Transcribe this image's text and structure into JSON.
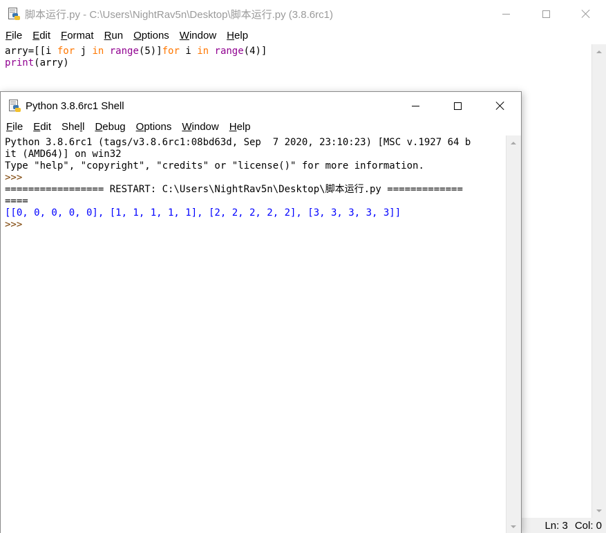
{
  "editor": {
    "title": "脚本运行.py - C:\\Users\\NightRav5n\\Desktop\\脚本运行.py (3.8.6rc1)",
    "menu": [
      {
        "label": "File",
        "mnemonic": "F",
        "rest": "ile"
      },
      {
        "label": "Edit",
        "mnemonic": "E",
        "rest": "dit"
      },
      {
        "label": "Format",
        "mnemonic": "F",
        "rest": "ormat"
      },
      {
        "label": "Run",
        "mnemonic": "R",
        "rest": "un"
      },
      {
        "label": "Options",
        "mnemonic": "O",
        "rest": "ptions"
      },
      {
        "label": "Window",
        "mnemonic": "W",
        "rest": "indow"
      },
      {
        "label": "Help",
        "mnemonic": "H",
        "rest": "elp"
      }
    ],
    "code": {
      "line1": {
        "a": "arry=[[i ",
        "kw1": "for",
        "b": " j ",
        "kw2": "in",
        "c": " ",
        "bi1": "range",
        "d": "(5)]",
        "kw3": "for",
        "e": " i ",
        "kw4": "in",
        "f": " ",
        "bi2": "range",
        "g": "(4)]"
      },
      "line2": {
        "bi": "print",
        "rest": "(arry)"
      }
    },
    "status": {
      "line": "Ln: 3",
      "col": "Col: 0"
    }
  },
  "shell": {
    "title": "Python 3.8.6rc1 Shell",
    "menu": [
      {
        "label": "File",
        "mnemonic": "F",
        "rest": "ile"
      },
      {
        "label": "Edit",
        "mnemonic": "E",
        "rest": "dit"
      },
      {
        "label": "Shell",
        "pre": "She",
        "mnemonic": "l",
        "rest": "l"
      },
      {
        "label": "Debug",
        "mnemonic": "D",
        "rest": "ebug"
      },
      {
        "label": "Options",
        "mnemonic": "O",
        "rest": "ptions"
      },
      {
        "label": "Window",
        "mnemonic": "W",
        "rest": "indow"
      },
      {
        "label": "Help",
        "mnemonic": "H",
        "rest": "elp"
      }
    ],
    "banner1": "Python 3.8.6rc1 (tags/v3.8.6rc1:08bd63d, Sep  7 2020, 23:10:23) [MSC v.1927 64 b",
    "banner2": "it (AMD64)] on win32",
    "banner3": "Type \"help\", \"copyright\", \"credits\" or \"license()\" for more information.",
    "prompt": ">>> ",
    "restart1": "================= RESTART: C:\\Users\\NightRav5n\\Desktop\\脚本运行.py =============",
    "restart2": "====",
    "output": "[[0, 0, 0, 0, 0], [1, 1, 1, 1, 1], [2, 2, 2, 2, 2], [3, 3, 3, 3, 3]]",
    "prompt2": ">>> "
  },
  "icons": {
    "app": "idle-python-icon",
    "minimize": "minimize-icon",
    "maximize": "maximize-icon",
    "close": "close-icon"
  }
}
